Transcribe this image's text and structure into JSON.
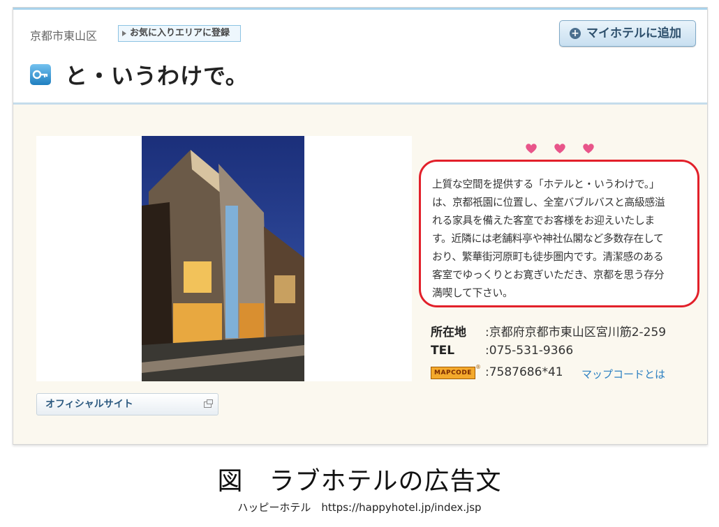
{
  "header": {
    "area": "京都市東山区",
    "favorite_area_button": "お気に入りエリアに登録",
    "add_my_hotel_button": "マイホテルに追加",
    "hotel_name": "と・いうわけで。"
  },
  "main": {
    "description_lines": [
      "上質な空間を提供する「ホテルと・いうわけで。」",
      "は、京都祇園に位置し、全室バブルバスと高級感溢",
      "れる家具を備えた客室でお客様をお迎えいたしま",
      "す。近隣には老舗料亭や神社仏閣など多数存在して",
      "おり、繁華街河原町も徒歩圏内です。清潔感のある",
      "客室でゆっくりとお寛ぎいただき、京都を思う存分",
      "満喫して下さい。"
    ],
    "address_label": "所在地",
    "address_value": ":京都府京都市東山区宮川筋2-259",
    "tel_label": "TEL",
    "tel_value": ":075-531-9366",
    "mapcode_logo": "MAPCODE",
    "mapcode_reg": "®",
    "mapcode_value": ":7587686*41",
    "mapcode_link": "マップコードとは",
    "official_site_button": "オフィシャルサイト",
    "heart_color": "#e8558a",
    "frame_color": "#e2202a"
  },
  "caption": "図　ラブホテルの広告文",
  "source": "ハッピーホテル　https://happyhotel.jp/index.jsp"
}
